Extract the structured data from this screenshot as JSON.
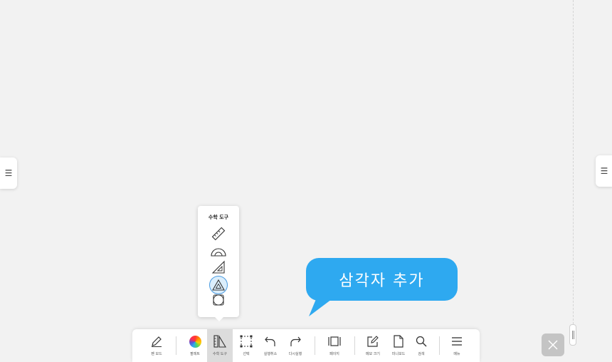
{
  "sidebars": {
    "left_icon": "menu-icon",
    "right_icon": "menu-icon",
    "glyph": "☰"
  },
  "math_popup": {
    "title": "수학 도구",
    "tools": [
      {
        "icon": "ruler-icon",
        "selected": false
      },
      {
        "icon": "protractor-icon",
        "selected": false
      },
      {
        "icon": "set-square-icon",
        "selected": false
      },
      {
        "icon": "triangle-add-icon",
        "selected": true
      },
      {
        "icon": "circle-tool-icon",
        "selected": false
      }
    ]
  },
  "tooltip": {
    "text": "삼각자 추가",
    "color": "#2ea9f0"
  },
  "toolbar": {
    "pen_mode": "펜 모드",
    "palette": "팔레트",
    "math_tools": "수학 도구",
    "select": "선택",
    "undo": "실행취소",
    "redo": "다시실행",
    "page": "페이지",
    "memo_size": "메모 크기",
    "mini_board": "미니보드",
    "search": "검색",
    "menu": "메뉴",
    "active": "math_tools"
  },
  "colors": {
    "canvas": "#f2f2f2",
    "accent": "#2ea9f0",
    "selected_ring": "#4a9be0",
    "close_button": "#c4c4c4"
  }
}
